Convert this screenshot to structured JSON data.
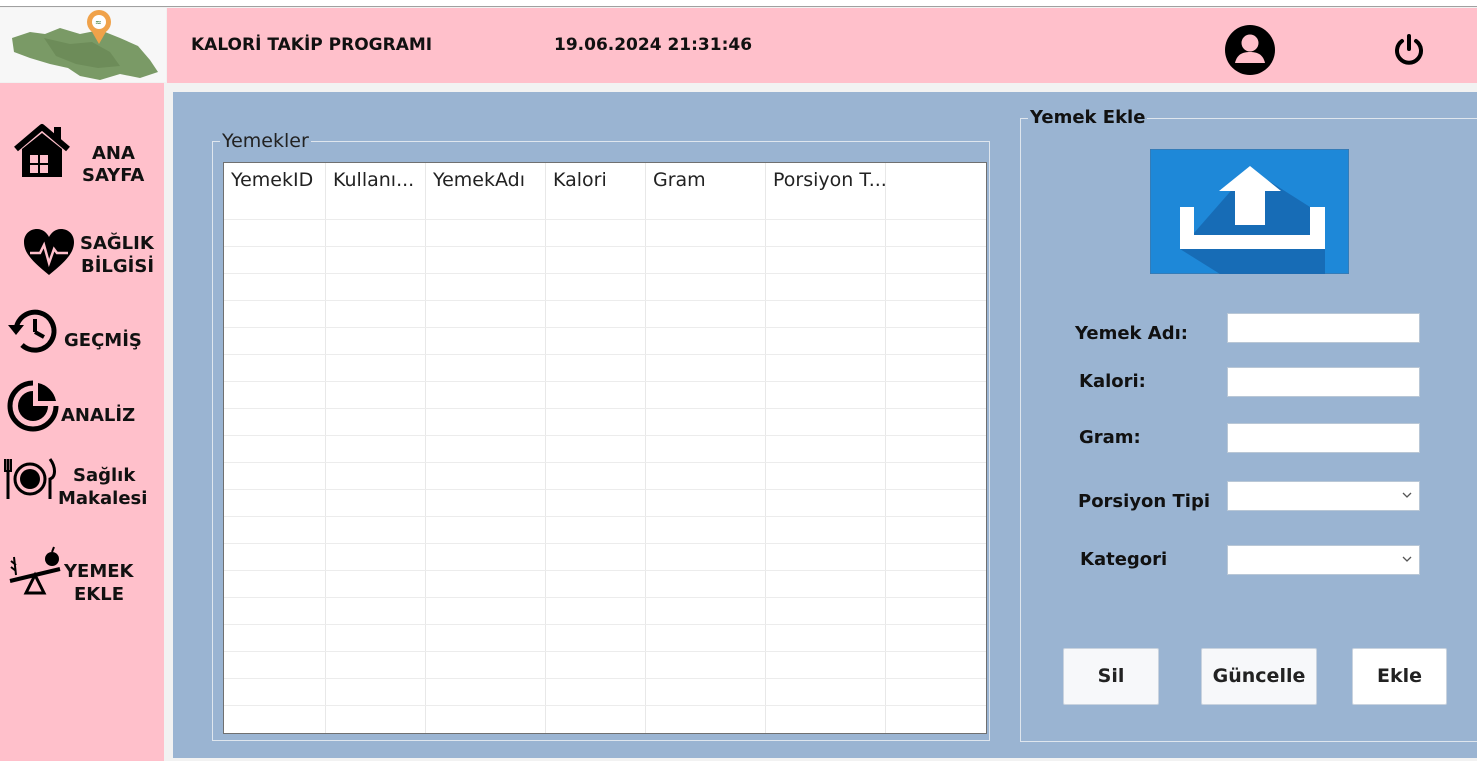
{
  "header": {
    "title": "KALORİ TAKİP PROGRAMI",
    "datetime": "19.06.2024 21:31:46",
    "user_icon": "user-circle-icon",
    "power_icon": "power-icon",
    "background": "#ffc0cb"
  },
  "sidebar": {
    "items": [
      {
        "label_line1": "ANA",
        "label_line2": "SAYFA",
        "icon": "home-icon"
      },
      {
        "label_line1": "SAĞLIK",
        "label_line2": "BİLGİSİ",
        "icon": "heart-pulse-icon"
      },
      {
        "label": "GEÇMİŞ",
        "icon": "history-icon"
      },
      {
        "label": "ANALİZ",
        "icon": "analysis-icon"
      },
      {
        "label_line1": "Sağlık",
        "label_line2": "Makalesi",
        "icon": "plate-cutlery-icon"
      },
      {
        "label_line1": "YEMEK",
        "label_line2": "EKLE",
        "icon": "food-scale-icon"
      }
    ]
  },
  "table_group": {
    "label": "Yemekler",
    "columns": [
      "YemekID",
      "Kullanı...",
      "YemekAdı",
      "Kalori",
      "Gram",
      "Porsiyon T..."
    ]
  },
  "form_group": {
    "label": "Yemek Ekle",
    "upload_icon": "upload-icon",
    "fields": {
      "yemek_adi": {
        "label": "Yemek Adı:",
        "value": ""
      },
      "kalori": {
        "label": "Kalori:",
        "value": ""
      },
      "gram": {
        "label": "Gram:",
        "value": ""
      },
      "porsiyon_tipi": {
        "label": "Porsiyon Tipi",
        "value": ""
      },
      "kategori": {
        "label": "Kategori",
        "value": ""
      }
    },
    "buttons": {
      "sil": "Sil",
      "guncelle": "Güncelle",
      "ekle": "Ekle"
    }
  },
  "colors": {
    "main_bg": "#9ab4d2",
    "sidebar_bg": "#ffc0cb",
    "upload_blue": "#1e88d8"
  }
}
